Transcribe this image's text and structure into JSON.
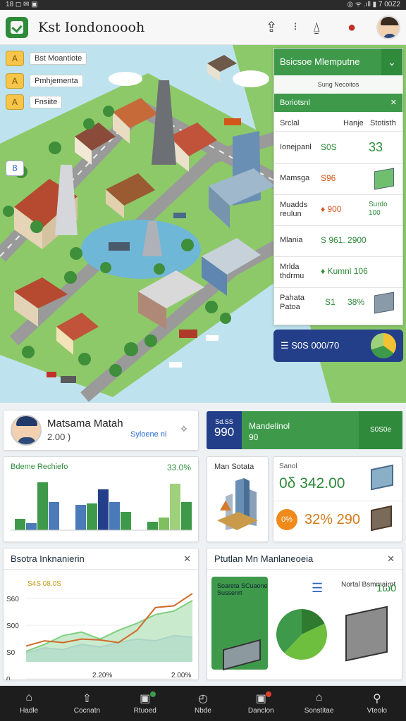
{
  "status_bar": {
    "left": "18 ◻ ✉ ▣",
    "right": "◎ ᯤ .ıll ▮ 7 00Z2"
  },
  "app": {
    "title": "Kst Iondonoooh"
  },
  "map_chips": [
    {
      "icon": "A",
      "label": "Bst Moantiote"
    },
    {
      "icon": "A",
      "label": "Pmhjementa"
    },
    {
      "icon": "A",
      "label": "Fnsiite"
    }
  ],
  "map_chip_blue": "8",
  "right_panel": {
    "title": "Bsicsoe Mlemputne",
    "subtitle": "Sung Necoitos",
    "section": "Boriotsnl",
    "columns": [
      "Srclal",
      "Hanje",
      "Stotisth"
    ],
    "rows": [
      {
        "name": "Ionejpanl",
        "v1": "S0S",
        "v2": "33",
        "v1_color": "#2e8b3a"
      },
      {
        "name": "Mamsga",
        "v1": "S96",
        "v2": "",
        "v1_color": "#d4551a"
      },
      {
        "name": "Muadds reulun",
        "v1": "♦ 900",
        "v2": "Surdo 100",
        "v1_color": "#d4551a"
      },
      {
        "name": "Mlania",
        "v1": "S 961. 2900",
        "v2": "",
        "v1_color": "#2e8b3a"
      },
      {
        "name": "Mrlda thdrmu",
        "v1": "♦ Kumnl 106",
        "v2": "",
        "v1_color": "#2e8b3a"
      },
      {
        "name": "Pahata Patoa",
        "v1": "S1",
        "v2": "38%",
        "v1_color": "#2e8b3a"
      }
    ],
    "bar_text": "☰ S0S 000/70"
  },
  "user_card": {
    "name": "Matsama Matah",
    "sub": "2.00 )",
    "link": "Syloene ni",
    "pin": "✧"
  },
  "green_card": {
    "num_top": "Sd.SS",
    "num_main": "990",
    "t1": "Mandelinol",
    "t2": "90",
    "t3": "S0S0e"
  },
  "bar_card": {
    "title": "Bdeme Rechiefo",
    "pct": "33.0%"
  },
  "bar_chart": {
    "type": "bar",
    "groups": [
      {
        "values": [
          16,
          10,
          68,
          40
        ],
        "colors": [
          "#3e9a4a",
          "#4a7ab8",
          "#3e9a4a",
          "#4a7ab8"
        ]
      },
      {
        "values": [
          36,
          38,
          58,
          40,
          26
        ],
        "colors": [
          "#4a7ab8",
          "#3e9a4a",
          "#243f8a",
          "#4a7ab8",
          "#3e9a4a"
        ]
      },
      {
        "values": [
          12,
          18,
          66,
          40
        ],
        "colors": [
          "#3e9a4a",
          "#7fbf5f",
          "#9fd07c",
          "#3e9a4a"
        ]
      }
    ],
    "ylim": [
      0,
      70
    ]
  },
  "city_card": {
    "title": "Man Sotata"
  },
  "stats_card": {
    "label": "Sanol",
    "v1": "0δ 342.00",
    "badge": "0%",
    "v2": "32% 290"
  },
  "line_card": {
    "title": "Bsotra Inknanierin"
  },
  "line_chart": {
    "type": "line",
    "legend": "S4S 08.0S",
    "yticks": [
      "S60",
      "S00",
      "S0",
      "0"
    ],
    "xticks": [
      "2.20%",
      "2.00%"
    ],
    "x": [
      0,
      1,
      2,
      3,
      4,
      5,
      6,
      7,
      8,
      9
    ],
    "series": [
      {
        "name": "orange",
        "color": "#d06a2a",
        "values": [
          18,
          24,
          22,
          26,
          25,
          22,
          36,
          62,
          64,
          78
        ]
      },
      {
        "name": "green",
        "color": "#7fcf7f",
        "values": [
          12,
          20,
          30,
          34,
          26,
          36,
          44,
          54,
          58,
          70
        ]
      },
      {
        "name": "blue",
        "color": "#3a6ad0",
        "values": [
          10,
          16,
          14,
          20,
          17,
          22,
          26,
          24,
          30,
          28
        ]
      }
    ],
    "ylim": [
      0,
      90
    ]
  },
  "pie_card": {
    "title": "Ptutlan Mn Manlaneoeia",
    "green_label": "Soareta SCuaone Sussenrt",
    "label": "Nortal Bsmmairnt",
    "num": "1ω0"
  },
  "pie_chart": {
    "type": "pie",
    "values": [
      18,
      44,
      38
    ],
    "colors": [
      "#2e7a2e",
      "#6fbf3f",
      "#3e9a4a"
    ]
  },
  "bottom_nav": [
    {
      "icon": "⌂",
      "label": "Hadle"
    },
    {
      "icon": "⇧",
      "label": "Cocnatn"
    },
    {
      "icon": "▣",
      "label": "Rtuoed"
    },
    {
      "icon": "◴",
      "label": "Nbde"
    },
    {
      "icon": "▣",
      "label": "Danclon"
    },
    {
      "icon": "⌂",
      "label": "Sonstitae"
    },
    {
      "icon": "⚲",
      "label": "Vteolo"
    }
  ]
}
